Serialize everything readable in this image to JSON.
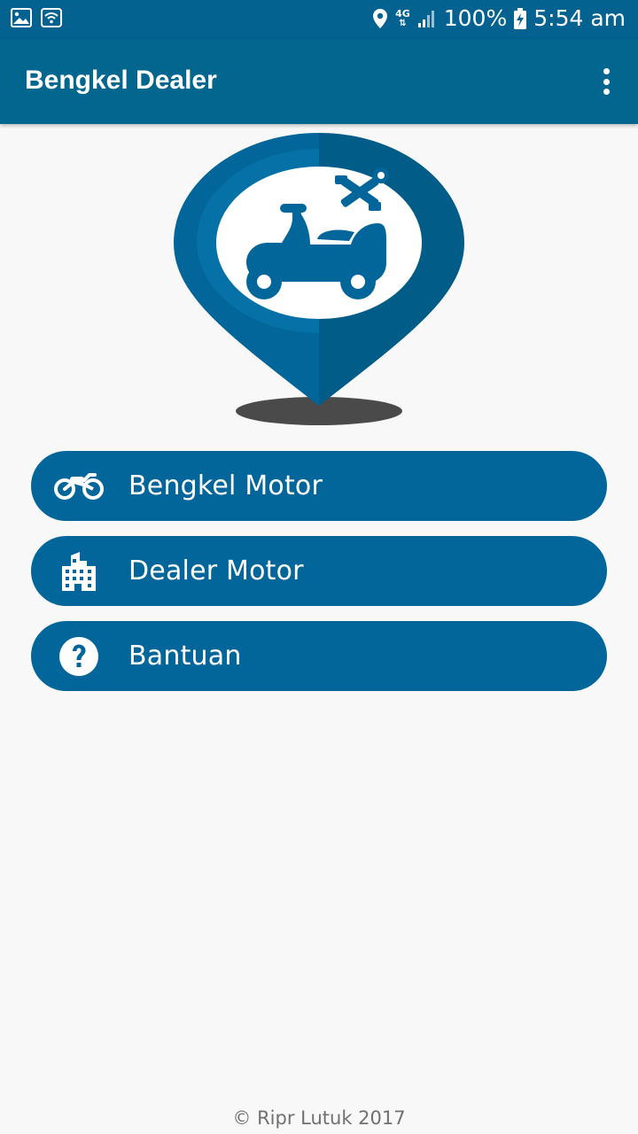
{
  "status_bar": {
    "network": "4G",
    "battery": "100%",
    "time": "5:54 am"
  },
  "app_bar": {
    "title": "Bengkel Dealer"
  },
  "menu": [
    {
      "label": "Bengkel Motor",
      "icon": "motorcycle-icon"
    },
    {
      "label": "Dealer Motor",
      "icon": "building-icon"
    },
    {
      "label": "Bantuan",
      "icon": "help-icon"
    }
  ],
  "footer": {
    "copyright": "© Ripr Lutuk 2017"
  },
  "colors": {
    "primary": "#03669A",
    "status_bar": "#03628F",
    "background": "#F8F8F8",
    "logo_dark": "#025C88",
    "logo_shadow": "#4A4A4A"
  }
}
